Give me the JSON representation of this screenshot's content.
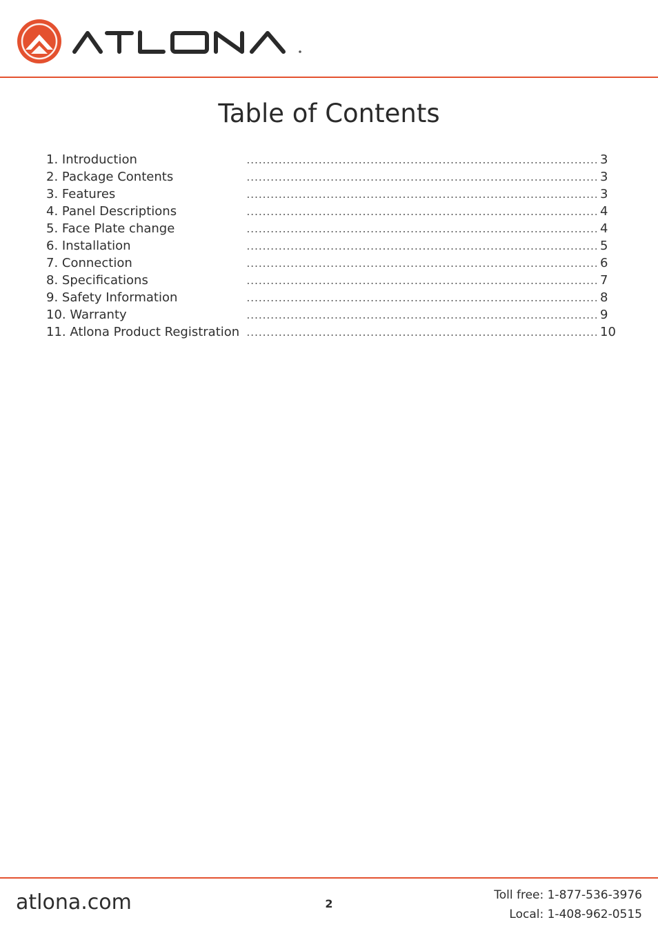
{
  "header": {
    "brand": "ATLONA",
    "logo_icon": "atlona-logo-icon",
    "accent_color": "#e4512f"
  },
  "page_title": "Table of Contents",
  "toc": [
    {
      "title": "1. Introduction",
      "page": "3"
    },
    {
      "title": "2. Package Contents",
      "page": "3"
    },
    {
      "title": "3. Features",
      "page": "3"
    },
    {
      "title": "4. Panel Descriptions",
      "page": "4"
    },
    {
      "title": "5. Face Plate change",
      "page": "4"
    },
    {
      "title": "6. Installation",
      "page": "5"
    },
    {
      "title": "7. Connection",
      "page": "6"
    },
    {
      "title": "8. Specifications",
      "page": "7"
    },
    {
      "title": "9. Safety Information",
      "page": "8"
    },
    {
      "title": "10. Warranty",
      "page": "9"
    },
    {
      "title": "11. Atlona Product Registration",
      "page": "10"
    }
  ],
  "footer": {
    "website": "atlona.com",
    "page_number": "2",
    "toll_free": "Toll free: 1-877-536-3976",
    "local": "Local: 1-408-962-0515"
  }
}
